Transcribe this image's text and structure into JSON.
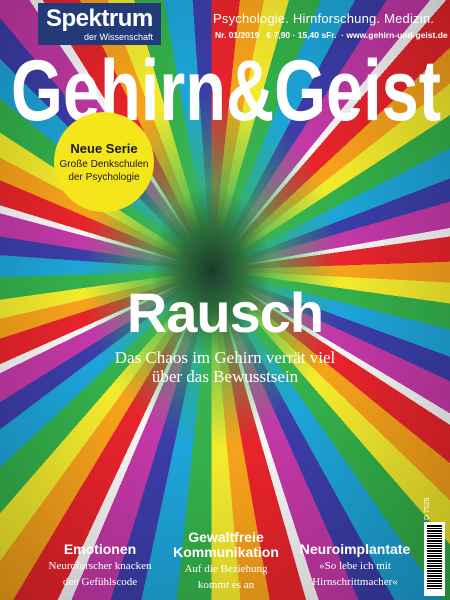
{
  "brand": {
    "name": "Spektrum",
    "sub": "der Wissenschaft"
  },
  "tagline": "Psychologie. Hirnforschung. Medizin.",
  "issue": {
    "number": "Nr. 01/2019",
    "price": "€ 7,90 · 15,40 sFr.",
    "url": "www.gehirn-und-geist.de"
  },
  "masthead": "Gehirn&Geist",
  "badge": {
    "title": "Neue Serie",
    "line1": "Große Denkschulen",
    "line2": "der Psychologie"
  },
  "cover": {
    "title": "Rausch",
    "subtitle_line1": "Das Chaos im Gehirn verrät viel",
    "subtitle_line2": "über das Bewusstsein"
  },
  "teasers": [
    {
      "title": "Emotionen",
      "line1": "Neuroforscher knacken",
      "line2": "den Gefühlscode"
    },
    {
      "title_line1": "Gewaltfreie",
      "title_line2": "Kommunikation",
      "line1": "Auf die Beziehung",
      "line2": "kommt es an"
    },
    {
      "title": "Neuroimplantate",
      "line1": "»So lebe ich mit",
      "line2": "Hirnschrittmacher«"
    }
  ],
  "price_code": "D 7525",
  "colors": {
    "brand_blue": "#233a78",
    "badge_yellow": "#f5e51b",
    "text_white": "#ffffff"
  }
}
